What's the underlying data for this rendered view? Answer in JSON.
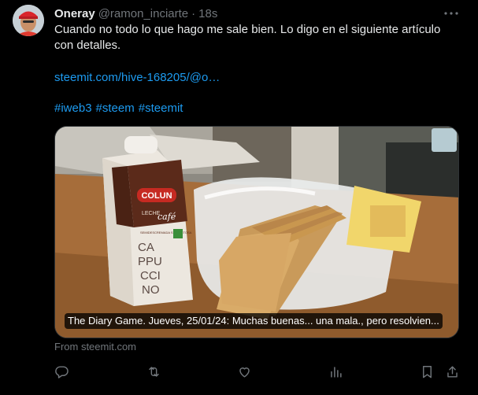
{
  "tweet": {
    "display_name": "Oneray",
    "handle": "@ramon_inciarte",
    "separator": "·",
    "time": "18s",
    "text": "Cuando no todo lo que hago me sale bien. Lo digo en el siguiente artículo con detalles.",
    "link": "steemit.com/hive-168205/@o…",
    "hashtags": [
      "#iweb3",
      "#steem",
      "#steemit"
    ]
  },
  "card": {
    "title": "The Diary Game. Jueves, 25/01/24: Muchas buenas... una mala., pero resolvien...",
    "source": "From steemit.com",
    "photo_text": {
      "brand": "COLUN",
      "product_line1": "LECHE",
      "product_line2": "café",
      "product_sub": "SEMIDESCREMADA SIN LACTOSA",
      "flavor": [
        "CA",
        "PPU",
        "CCI",
        "NO"
      ]
    }
  },
  "icons": {
    "more": "more-horizontal-icon",
    "reply": "reply-icon",
    "retweet": "retweet-icon",
    "like": "heart-icon",
    "views": "analytics-icon",
    "bookmark": "bookmark-icon",
    "share": "share-icon"
  },
  "colors": {
    "background": "#000000",
    "text": "#e7e9ea",
    "secondary": "#71767b",
    "link": "#1d9bf0"
  }
}
